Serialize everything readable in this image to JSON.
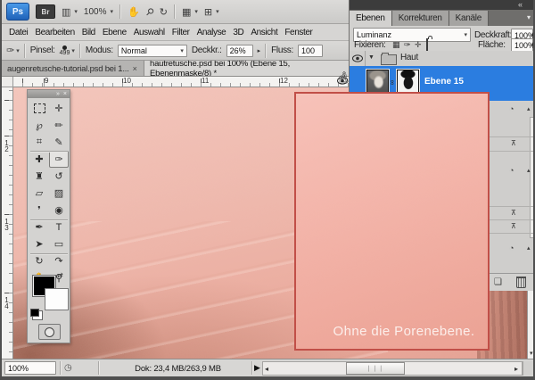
{
  "app_bar": {
    "logo": "Ps",
    "bridge": "Br",
    "zoom_value": "100%"
  },
  "menu": {
    "items": [
      "Datei",
      "Bearbeiten",
      "Bild",
      "Ebene",
      "Auswahl",
      "Filter",
      "Analyse",
      "3D",
      "Ansicht",
      "Fenster"
    ]
  },
  "options": {
    "pinsel_label": "Pinsel:",
    "brush_size": "499",
    "modus_label": "Modus:",
    "modus_value": "Normal",
    "deckkr_label": "Deckkr.:",
    "deckkr_value": "26%",
    "fluss_label": "Fluss:",
    "fluss_value": "100"
  },
  "tabs": {
    "tab1_title": "augenretusche-tutorial.psd bei 1...",
    "tab2_title": "hautretusche.psd bei 100% (Ebene 15, Ebenenmaske/8) *"
  },
  "ruler": {
    "h": [
      "9",
      "10",
      "11",
      "12"
    ],
    "v": [
      "12",
      "13",
      "14"
    ]
  },
  "toolbar": {
    "tools": [
      {
        "name": "rectangular-marquee-tool",
        "glyph": ""
      },
      {
        "name": "move-tool",
        "glyph": "✛"
      },
      {
        "name": "lasso-tool",
        "glyph": "℘"
      },
      {
        "name": "quick-selection-tool",
        "glyph": "✏"
      },
      {
        "name": "crop-tool",
        "glyph": "⌗"
      },
      {
        "name": "eyedropper-tool",
        "glyph": "✎"
      },
      {
        "name": "healing-brush-tool",
        "glyph": "✚"
      },
      {
        "name": "brush-tool",
        "glyph": "✑"
      },
      {
        "name": "clone-stamp-tool",
        "glyph": "♜"
      },
      {
        "name": "history-brush-tool",
        "glyph": "↺"
      },
      {
        "name": "eraser-tool",
        "glyph": "▱"
      },
      {
        "name": "gradient-tool",
        "glyph": "▨"
      },
      {
        "name": "blur-tool",
        "glyph": "❜"
      },
      {
        "name": "dodge-tool",
        "glyph": "◉"
      },
      {
        "name": "pen-tool",
        "glyph": "✒"
      },
      {
        "name": "type-tool",
        "glyph": "T"
      },
      {
        "name": "path-selection-tool",
        "glyph": "➤"
      },
      {
        "name": "shape-tool",
        "glyph": "▭"
      },
      {
        "name": "3d-rotate-tool",
        "glyph": "↻"
      },
      {
        "name": "3d-orbit-tool",
        "glyph": "↷"
      },
      {
        "name": "hand-tool",
        "glyph": "✋"
      },
      {
        "name": "zoom-tool",
        "glyph": "⚲"
      }
    ]
  },
  "panel": {
    "tab_ebenen": "Ebenen",
    "tab_korrekturen": "Korrekturen",
    "tab_kanaele": "Kanäle",
    "blend_mode": "Luminanz",
    "deckkraft_label": "Deckkraft:",
    "deckkraft_value": "100%",
    "fixieren_label": "Fixieren:",
    "flaeche_label": "Fläche:",
    "flaeche_value": "100%",
    "group_name": "Haut",
    "layer_name": "Ebene 15"
  },
  "overlay": {
    "caption": "Ohne die Porenebene."
  },
  "status": {
    "zoom": "100%",
    "doc_info": "Dok: 23,4 MB/263,9 MB"
  },
  "icons": {
    "collapse": "«",
    "panel_menu": "▾",
    "close": "×",
    "dropdown": "▾",
    "spinner": "▸",
    "film": "▥",
    "hand": "✋",
    "magnify": "⚲",
    "rotate_view": "↻",
    "panel_grid": "▦",
    "arrange": "⊞",
    "toolbar_more": "»",
    "swap": "⇄",
    "expand_triangle": "▼",
    "adjustment_badge": "◔",
    "row_triangle": "▴",
    "row_glyph": "⊼",
    "new_layer": "❏",
    "link": "∞",
    "clock": "◷",
    "status_arrow": "▶",
    "scroll_left": "◂",
    "scroll_right": "▸",
    "scroll_down": "▾",
    "grip": "❘❘❘",
    "cursor_hand": "☝",
    "brush_tool_icon": "✑",
    "fix_transparency": "▦",
    "fix_brush": "✑",
    "fix_move": "✛"
  },
  "colors": {
    "selection_blue": "#2b7de0",
    "overlay_border": "#c14f48",
    "overlay_fill": "#f3b3a8",
    "panel_dark": "#3c3c3c"
  }
}
